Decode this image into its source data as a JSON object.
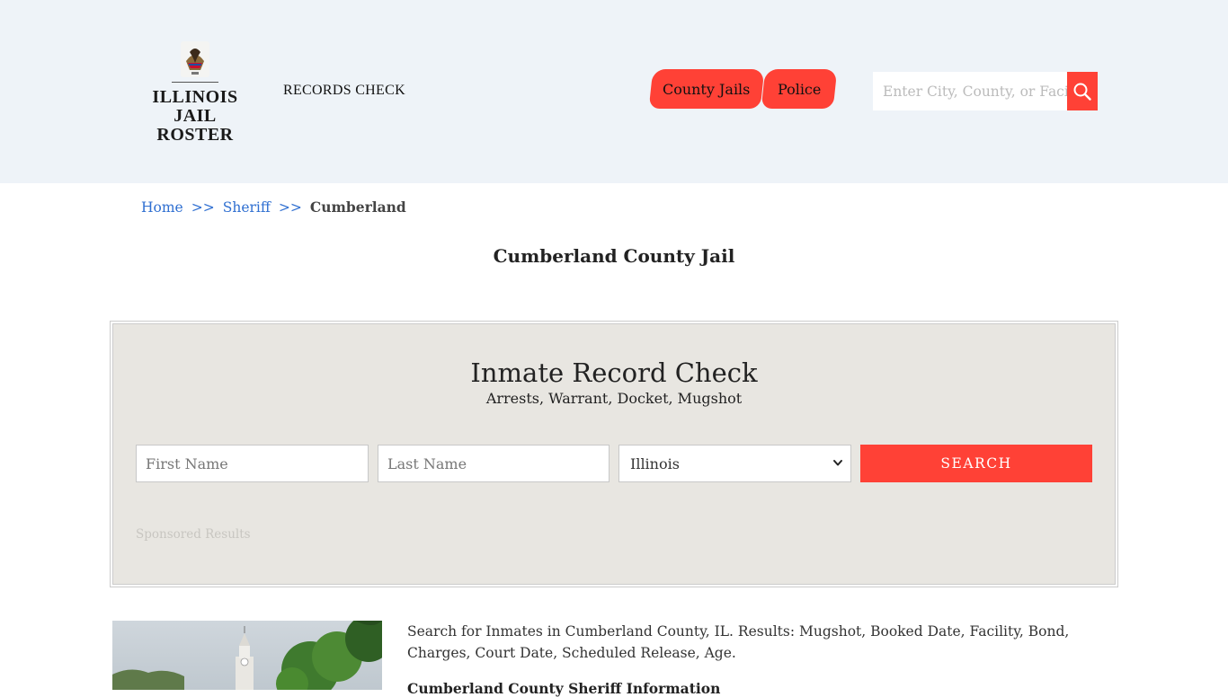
{
  "header": {
    "logo": {
      "line1": "ILLINOIS",
      "line2": "JAIL ROSTER",
      "seal_icon": "illinois-state-seal-icon"
    },
    "records_link": "RECORDS CHECK",
    "nav": [
      {
        "label": "County Jails"
      },
      {
        "label": "Police"
      }
    ],
    "search": {
      "placeholder": "Enter City, County, or Facility",
      "icon": "search-icon"
    }
  },
  "breadcrumb": {
    "home": "Home",
    "separator": ">>",
    "sheriff": "Sheriff",
    "current": "Cumberland"
  },
  "page_title": "Cumberland County Jail",
  "record_check": {
    "title": "Inmate Record Check",
    "subtitle": "Arrests, Warrant, Docket, Mugshot",
    "first_name_placeholder": "First Name",
    "last_name_placeholder": "Last Name",
    "state_selected": "Illinois",
    "search_label": "SEARCH",
    "sponsored_label": "Sponsored Results"
  },
  "content": {
    "intro": "Search for Inmates in Cumberland County, IL. Results: Mugshot, Booked Date, Facility, Bond, Charges, Court Date, Scheduled Release, Age.",
    "subhead": "Cumberland County Sheriff Information"
  },
  "colors": {
    "header_bg": "#eef3f8",
    "accent": "#ff4136",
    "link": "#2f6fd1",
    "panel_bg": "#e8e6e1"
  }
}
